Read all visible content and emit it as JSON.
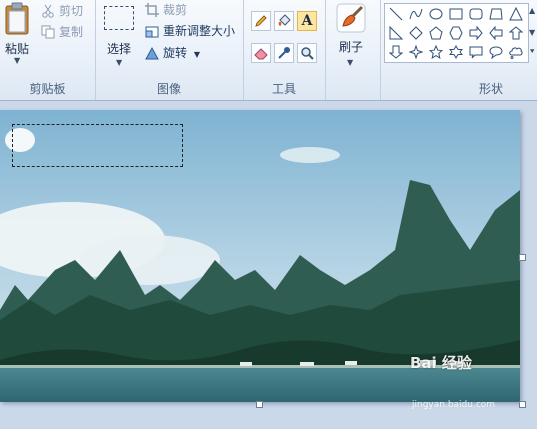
{
  "clipboard": {
    "paste": "粘贴",
    "cut": "剪切",
    "copy": "复制",
    "group": "剪贴板"
  },
  "image": {
    "select": "选择",
    "crop": "裁剪",
    "resize": "重新调整大小",
    "rotate": "旋转",
    "group": "图像"
  },
  "tools": {
    "group": "工具",
    "items": [
      "pencil-icon",
      "fill-icon",
      "text-icon",
      "eraser-icon",
      "color-picker-icon",
      "magnifier-icon"
    ]
  },
  "brushes": {
    "label": "刷子"
  },
  "shapes": {
    "group": "形状"
  },
  "watermark": {
    "brand": "Bai 经验",
    "url": "jingyan.baidu.com"
  },
  "colors": {
    "accent": "#1e3a5f",
    "ribbon": "#eaf1f9",
    "active_tool": "#fde7a0"
  }
}
